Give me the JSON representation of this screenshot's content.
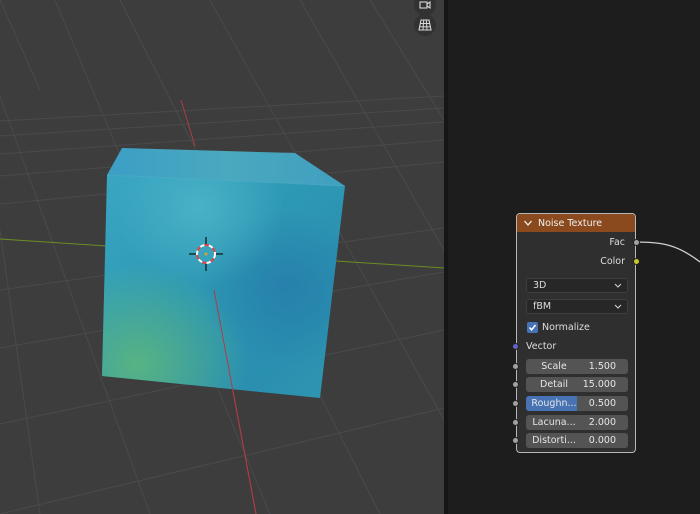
{
  "viewport": {
    "header_buttons": [
      {
        "icon": "camera-icon"
      },
      {
        "icon": "grid-icon"
      }
    ],
    "colors": {
      "background": "#3d3d3d",
      "x_axis": "#b03c44",
      "y_axis": "#6b8e23",
      "cube_base": "#2f9fb6"
    },
    "object": "cube with noise texture",
    "cursor_icon": "3d-cursor-icon"
  },
  "node": {
    "title": "Noise Texture",
    "header_color": "#8a4a1d",
    "outputs": [
      {
        "label": "Fac",
        "socket_color": "#a1a1a1"
      },
      {
        "label": "Color",
        "socket_color": "#c7c729"
      }
    ],
    "dimensions": "3D",
    "type": "fBM",
    "normalize": {
      "label": "Normalize",
      "checked": true
    },
    "vector_label": "Vector",
    "vector_socket_color": "#6363c7",
    "fields": [
      {
        "label": "Scale",
        "value": "1.500"
      },
      {
        "label": "Detail",
        "value": "15.000"
      },
      {
        "label": "Roughn...",
        "value": "0.500",
        "fill": 0.5
      },
      {
        "label": "Lacuna...",
        "value": "2.000"
      },
      {
        "label": "Distorti...",
        "value": "0.000"
      }
    ]
  }
}
